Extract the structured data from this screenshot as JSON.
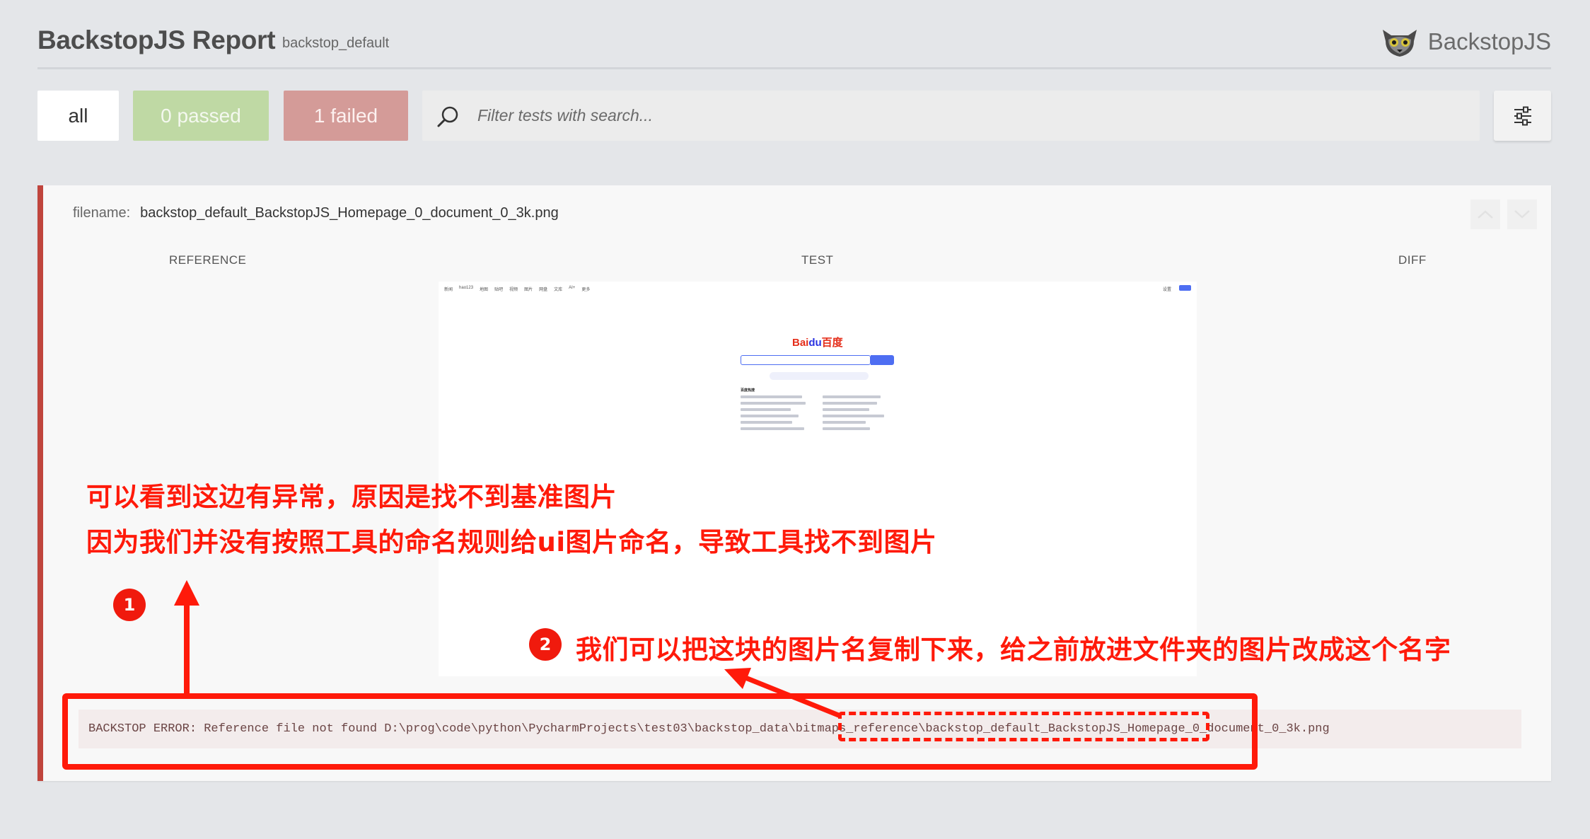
{
  "header": {
    "title": "BackstopJS Report",
    "suite": "backstop_default",
    "brand": "BackstopJS"
  },
  "toolbar": {
    "all_label": "all",
    "passed_label": "0 passed",
    "failed_label": "1 failed",
    "search_placeholder": "Filter tests with search...",
    "icons": {
      "search": "search-icon",
      "settings": "sliders-icon"
    }
  },
  "test": {
    "filename_label": "filename:",
    "filename": "backstop_default_BackstopJS_Homepage_0_document_0_3k.png",
    "columns": [
      "REFERENCE",
      "TEST",
      "DIFF"
    ],
    "error": "BACKSTOP ERROR: Reference file not found D:\\prog\\code\\python\\PycharmProjects\\test03\\backstop_data\\bitmaps_reference\\backstop_default_BackstopJS_Homepage_0_document_0_3k.png"
  },
  "annotations": {
    "line1": "可以看到这边有异常，原因是找不到基准图片",
    "line2": "因为我们并没有按照工具的命名规则给ui图片命名，导致工具找不到图片",
    "line3": "我们可以把这块的图片名复制下来，给之前放进文件夹的图片改成这个名字",
    "badge1": "1",
    "badge2": "2"
  },
  "colors": {
    "fail": "#c0453d",
    "passed_bg": "#bfd9a4",
    "failed_bg": "#d49b98",
    "annotation": "#ff1a0a"
  }
}
